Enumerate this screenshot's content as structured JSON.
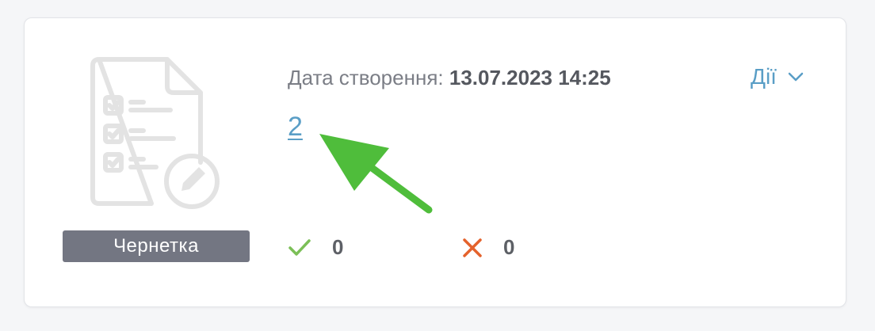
{
  "card": {
    "created_label": "Дата створення:",
    "created_value": "13.07.2023 14:25",
    "actions_label": "Дії",
    "document_link": "2",
    "status": "Чернетка",
    "approved_count": "0",
    "rejected_count": "0"
  },
  "colors": {
    "link": "#5a9ec6",
    "badge": "#737682",
    "approved": "#7bbf57",
    "rejected": "#e4622c",
    "annotation_arrow": "#4fbd3b"
  },
  "icons": {
    "illustration": "document-checklist-edit-icon",
    "actions": "chevron-down-icon",
    "approved": "check-icon",
    "rejected": "cross-icon"
  }
}
